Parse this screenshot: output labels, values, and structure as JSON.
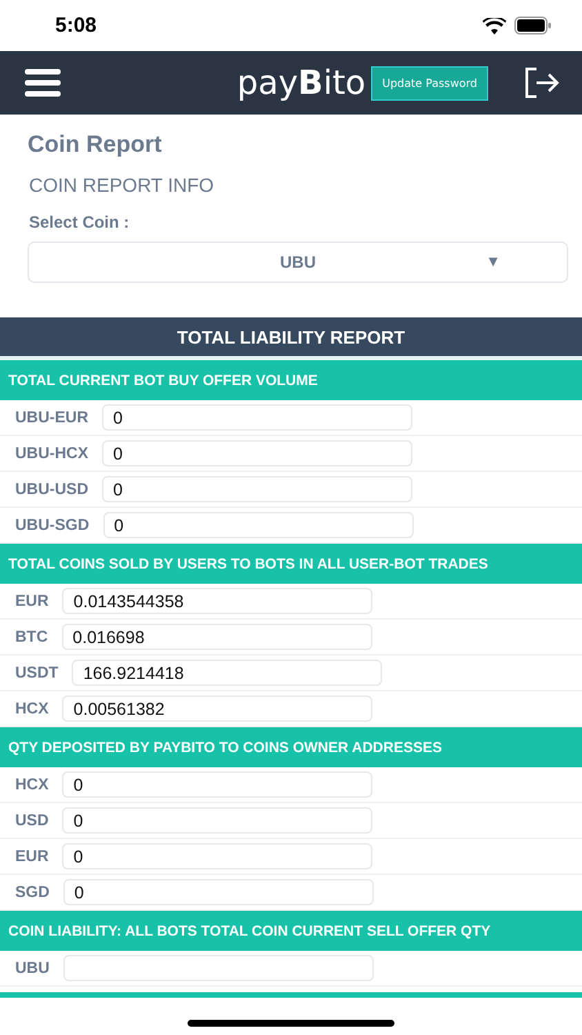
{
  "status_bar": {
    "time": "5:08"
  },
  "nav": {
    "logo": "pay**B**ito",
    "button": "Update Password"
  },
  "page": {
    "title": "Coin Report",
    "subtitle": "COIN REPORT INFO",
    "select_label": "Select Coin :",
    "select_value": "UBU",
    "select_arrow": "▼"
  },
  "report": {
    "title": "TOTAL LIABILITY REPORT",
    "sections": [
      {
        "title": "TOTAL CURRENT BOT BUY OFFER VOLUME",
        "rows": [
          {
            "label": "UBU-EUR",
            "value": "0"
          },
          {
            "label": "UBU-HCX",
            "value": "0"
          },
          {
            "label": "UBU-USD",
            "value": "0"
          },
          {
            "label": "UBU-SGD",
            "value": "0"
          }
        ]
      },
      {
        "title": "TOTAL COINS SOLD BY USERS TO BOTS IN ALL USER-BOT TRADES",
        "rows": [
          {
            "label": "EUR",
            "value": "0.0143544358"
          },
          {
            "label": "BTC",
            "value": "0.016698"
          },
          {
            "label": "USDT",
            "value": "166.9214418"
          },
          {
            "label": "HCX",
            "value": "0.00561382"
          }
        ]
      },
      {
        "title": "QTY DEPOSITED BY PAYBITO TO COINS OWNER ADDRESSES",
        "rows": [
          {
            "label": "HCX",
            "value": "0"
          },
          {
            "label": "USD",
            "value": "0"
          },
          {
            "label": "EUR",
            "value": "0"
          },
          {
            "label": "SGD",
            "value": "0"
          }
        ]
      },
      {
        "title": "COIN LIABILITY: ALL BOTS TOTAL COIN CURRENT SELL OFFER QTY",
        "rows": [
          {
            "label": "UBU"
          }
        ]
      }
    ]
  }
}
